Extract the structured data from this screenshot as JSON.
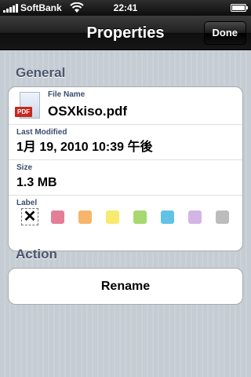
{
  "status_bar": {
    "carrier": "SoftBank",
    "time": "22:41"
  },
  "nav": {
    "title": "Properties",
    "done_label": "Done"
  },
  "general": {
    "header": "General",
    "file_name_label": "File Name",
    "file_name": "OSXkiso.pdf",
    "file_icon_badge": "PDF",
    "last_modified_label": "Last Modified",
    "last_modified": "1月 19, 2010 10:39 午後",
    "size_label": "Size",
    "size": "1.3 MB",
    "label_label": "Label",
    "label_none_glyph": "✕",
    "label_colors": [
      "#e47e96",
      "#f7b56b",
      "#f7ea6e",
      "#a6d86f",
      "#62c2e5",
      "#d3b5e5",
      "#bcbcbc"
    ]
  },
  "action": {
    "header": "Action",
    "rename_label": "Rename"
  }
}
